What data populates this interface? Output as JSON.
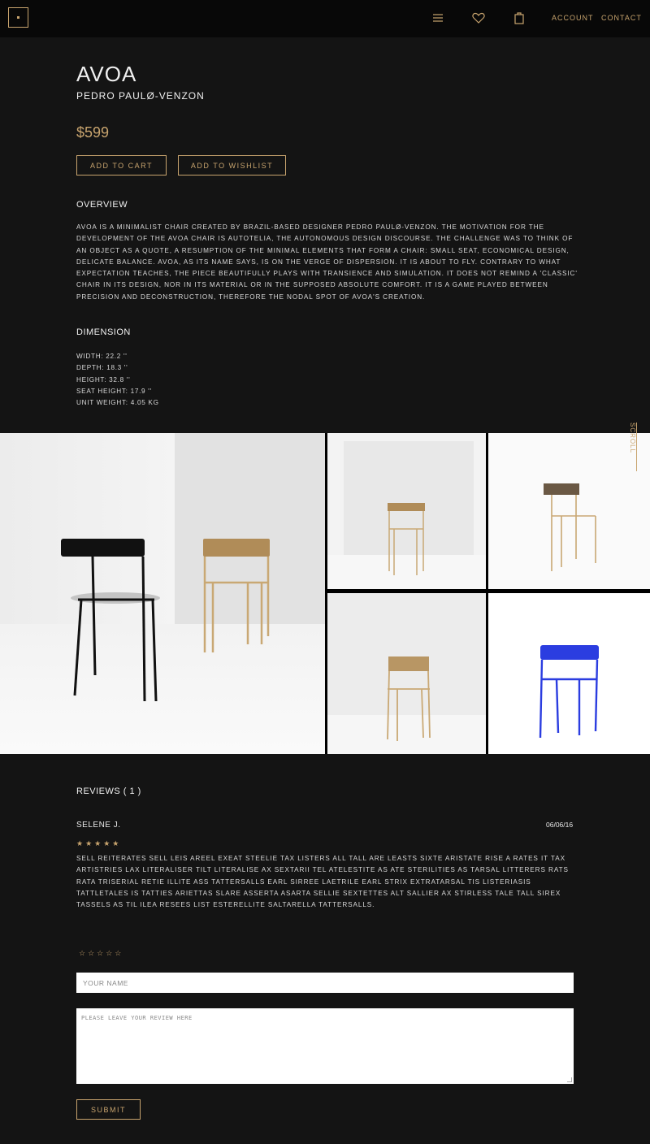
{
  "nav": {
    "account": "ACCOUNT",
    "contact": "CONTACT",
    "icons": [
      "menu-icon",
      "heart-icon",
      "bag-icon"
    ]
  },
  "product": {
    "title": "AVOA",
    "designer": "PEDRO PAULØ-VENZON",
    "price": "$599",
    "add_to_cart": "ADD TO CART",
    "add_to_wishlist": "ADD TO WISHLIST"
  },
  "overview": {
    "heading": "OVERVIEW",
    "text": "AVOA IS A MINIMALIST CHAIR CREATED BY BRAZIL-BASED DESIGNER PEDRO PAULØ-VENZON. THE MOTIVATION FOR THE DEVELOPMENT OF THE AVOA CHAIR IS AUTOTELIA, THE AUTONOMOUS DESIGN DISCOURSE. THE CHALLENGE WAS TO THINK OF AN OBJECT AS A QUOTE, A RESUMPTION OF THE MINIMAL ELEMENTS THAT FORM A CHAIR: SMALL SEAT, ECONOMICAL DESIGN, DELICATE BALANCE. AVOA, AS ITS NAME SAYS, IS ON THE VERGE OF DISPERSION. IT IS ABOUT TO FLY. CONTRARY TO WHAT EXPECTATION TEACHES, THE PIECE BEAUTIFULLY PLAYS WITH TRANSIENCE AND SIMULATION. IT DOES NOT REMIND A 'CLASSIC' CHAIR IN ITS DESIGN, NOR IN ITS MATERIAL OR IN THE SUPPOSED ABSOLUTE COMFORT. IT IS A GAME PLAYED BETWEEN PRECISION AND DECONSTRUCTION, THEREFORE THE NODAL SPOT OF AVOA'S CREATION."
  },
  "dimension": {
    "heading": "DIMENSION",
    "items": [
      "WIDTH: 22.2 ''",
      "DEPTH: 18.3 ''",
      "HEIGHT: 32.8 ''",
      "SEAT HEIGHT: 17.9 ''",
      "UNIT WEIGHT: 4.05 KG"
    ]
  },
  "scroll_label": "SCROLL",
  "colors": {
    "accent": "#c8a46e",
    "background": "#141414",
    "topbar": "#080808",
    "chair_blue": "#2b3de0",
    "chair_gold": "#c9a874"
  },
  "reviews": {
    "heading": "REVIEWS ( 1 )",
    "list": [
      {
        "name": "SELENE J.",
        "date": "06/06/16",
        "stars": "★★★★★",
        "rating": 5,
        "text": "SELL REITERATES SELL LEIS AREEL EXEAT STEELIE TAX LISTERS ALL TALL ARE LEASTS SIXTE ARISTATE RISE A RATES IT TAX ARTISTRIES LAX LITERALISER TILT LITERALISE AX SEXTARII TEL ATELESTITE AS ATE STERILITIES AS TARSAL LITTERERS RATS RATA TRISERIAL RETIE ILLITE ASS TATTERSALLS EARL SIRREE LAETRILE EARL STRIX EXTRATARSAL TIS LISTERIASIS TATTLETALES IS TATTIES ARIETTAS SLARE ASSERTA ASARTA SELLIE SEXTETTES ALT SALLIER AX STIRLESS TALE TALL SIREX TASSELS AS TIL ILEA RESEES LIST ESTERELLITE SALTARELLA TATTERSALLS."
      }
    ]
  },
  "form": {
    "rating_stars": "☆☆☆☆☆",
    "name_placeholder": "YOUR NAME",
    "review_placeholder": "PLEASE LEAVE YOUR REVIEW HERE",
    "submit": "SUBMIT"
  }
}
